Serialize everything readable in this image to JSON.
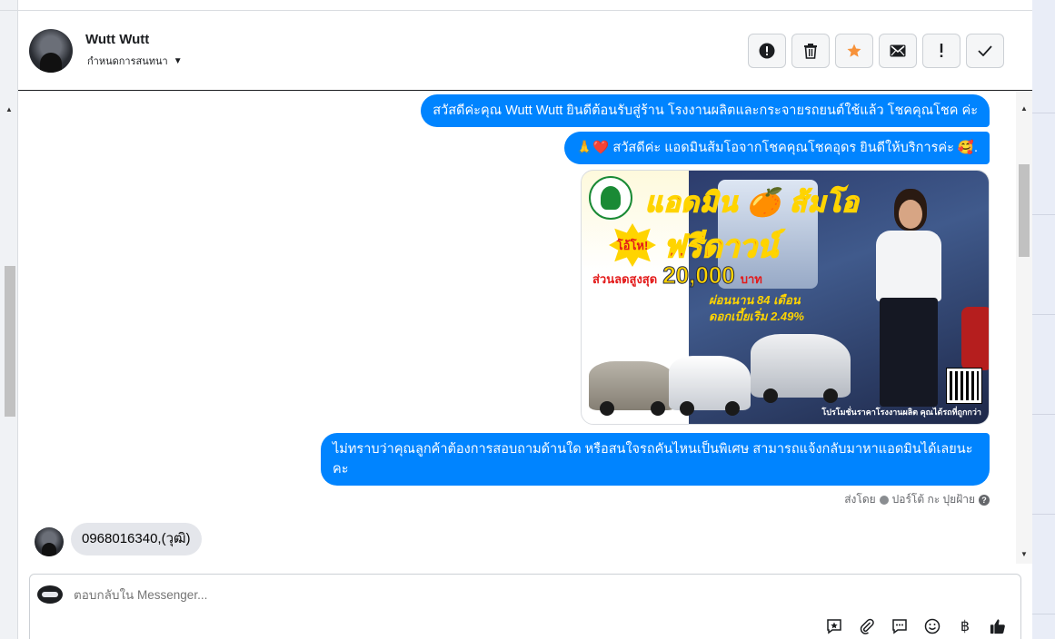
{
  "contact": {
    "name": "Wutt Wutt",
    "conversation_menu_label": "กำหนดการสนทนา"
  },
  "toolbar": {
    "actions": [
      "mark-spam",
      "delete",
      "star",
      "mark-unread",
      "flag",
      "mark-done"
    ]
  },
  "messages": {
    "outgoing_1": "สวัสดีค่ะคุณ Wutt Wutt ยินดีต้อนรับสู่ร้าน โรงงานผลิตและกระจายรถยนต์ใช้แล้ว โชคคุณโชค ค่ะ",
    "outgoing_2": "🙏❤️ สวัสดีค่ะ แอดมินส้มโอจากโชคคุณโชคอุดร ยินดีให้บริการค่ะ 🥰.",
    "outgoing_3": "ไม่ทราบว่าคุณลูกค้าต้องการสอบถามด้านใด หรือสนใจรถคันไหนเป็นพิเศษ สามารถแจ้งกลับมาหาแอดมินได้เลยนะคะ",
    "incoming_1": "0968016340,(วุฒิ)"
  },
  "promo_image": {
    "title_line1": "แอดมิน 🍊 ส้มโอ",
    "badge": "โอ้โห!",
    "title_line2": "ฟรีดาวน์",
    "discount_label": "ส่วนลดสูงสุด",
    "discount_amount": "20,000",
    "discount_unit": "บาท",
    "installment": "ผ่อนนาน 84 เดือน",
    "interest": "ดอกเบี้ยเริ่ม 2.49%",
    "footer": "โปรโมชั่นราคาโรงงานผลิต คุณได้รถที่ถูกกว่า"
  },
  "sent_by": {
    "prefix": "ส่งโดย",
    "name": "ปอร์โต้ กะ ปุยฝ้าย"
  },
  "composer": {
    "placeholder": "ตอบกลับใน Messenger..."
  },
  "colors": {
    "outgoing_bubble": "#0084ff",
    "incoming_bubble": "#e4e6eb",
    "star": "#f7923a"
  }
}
